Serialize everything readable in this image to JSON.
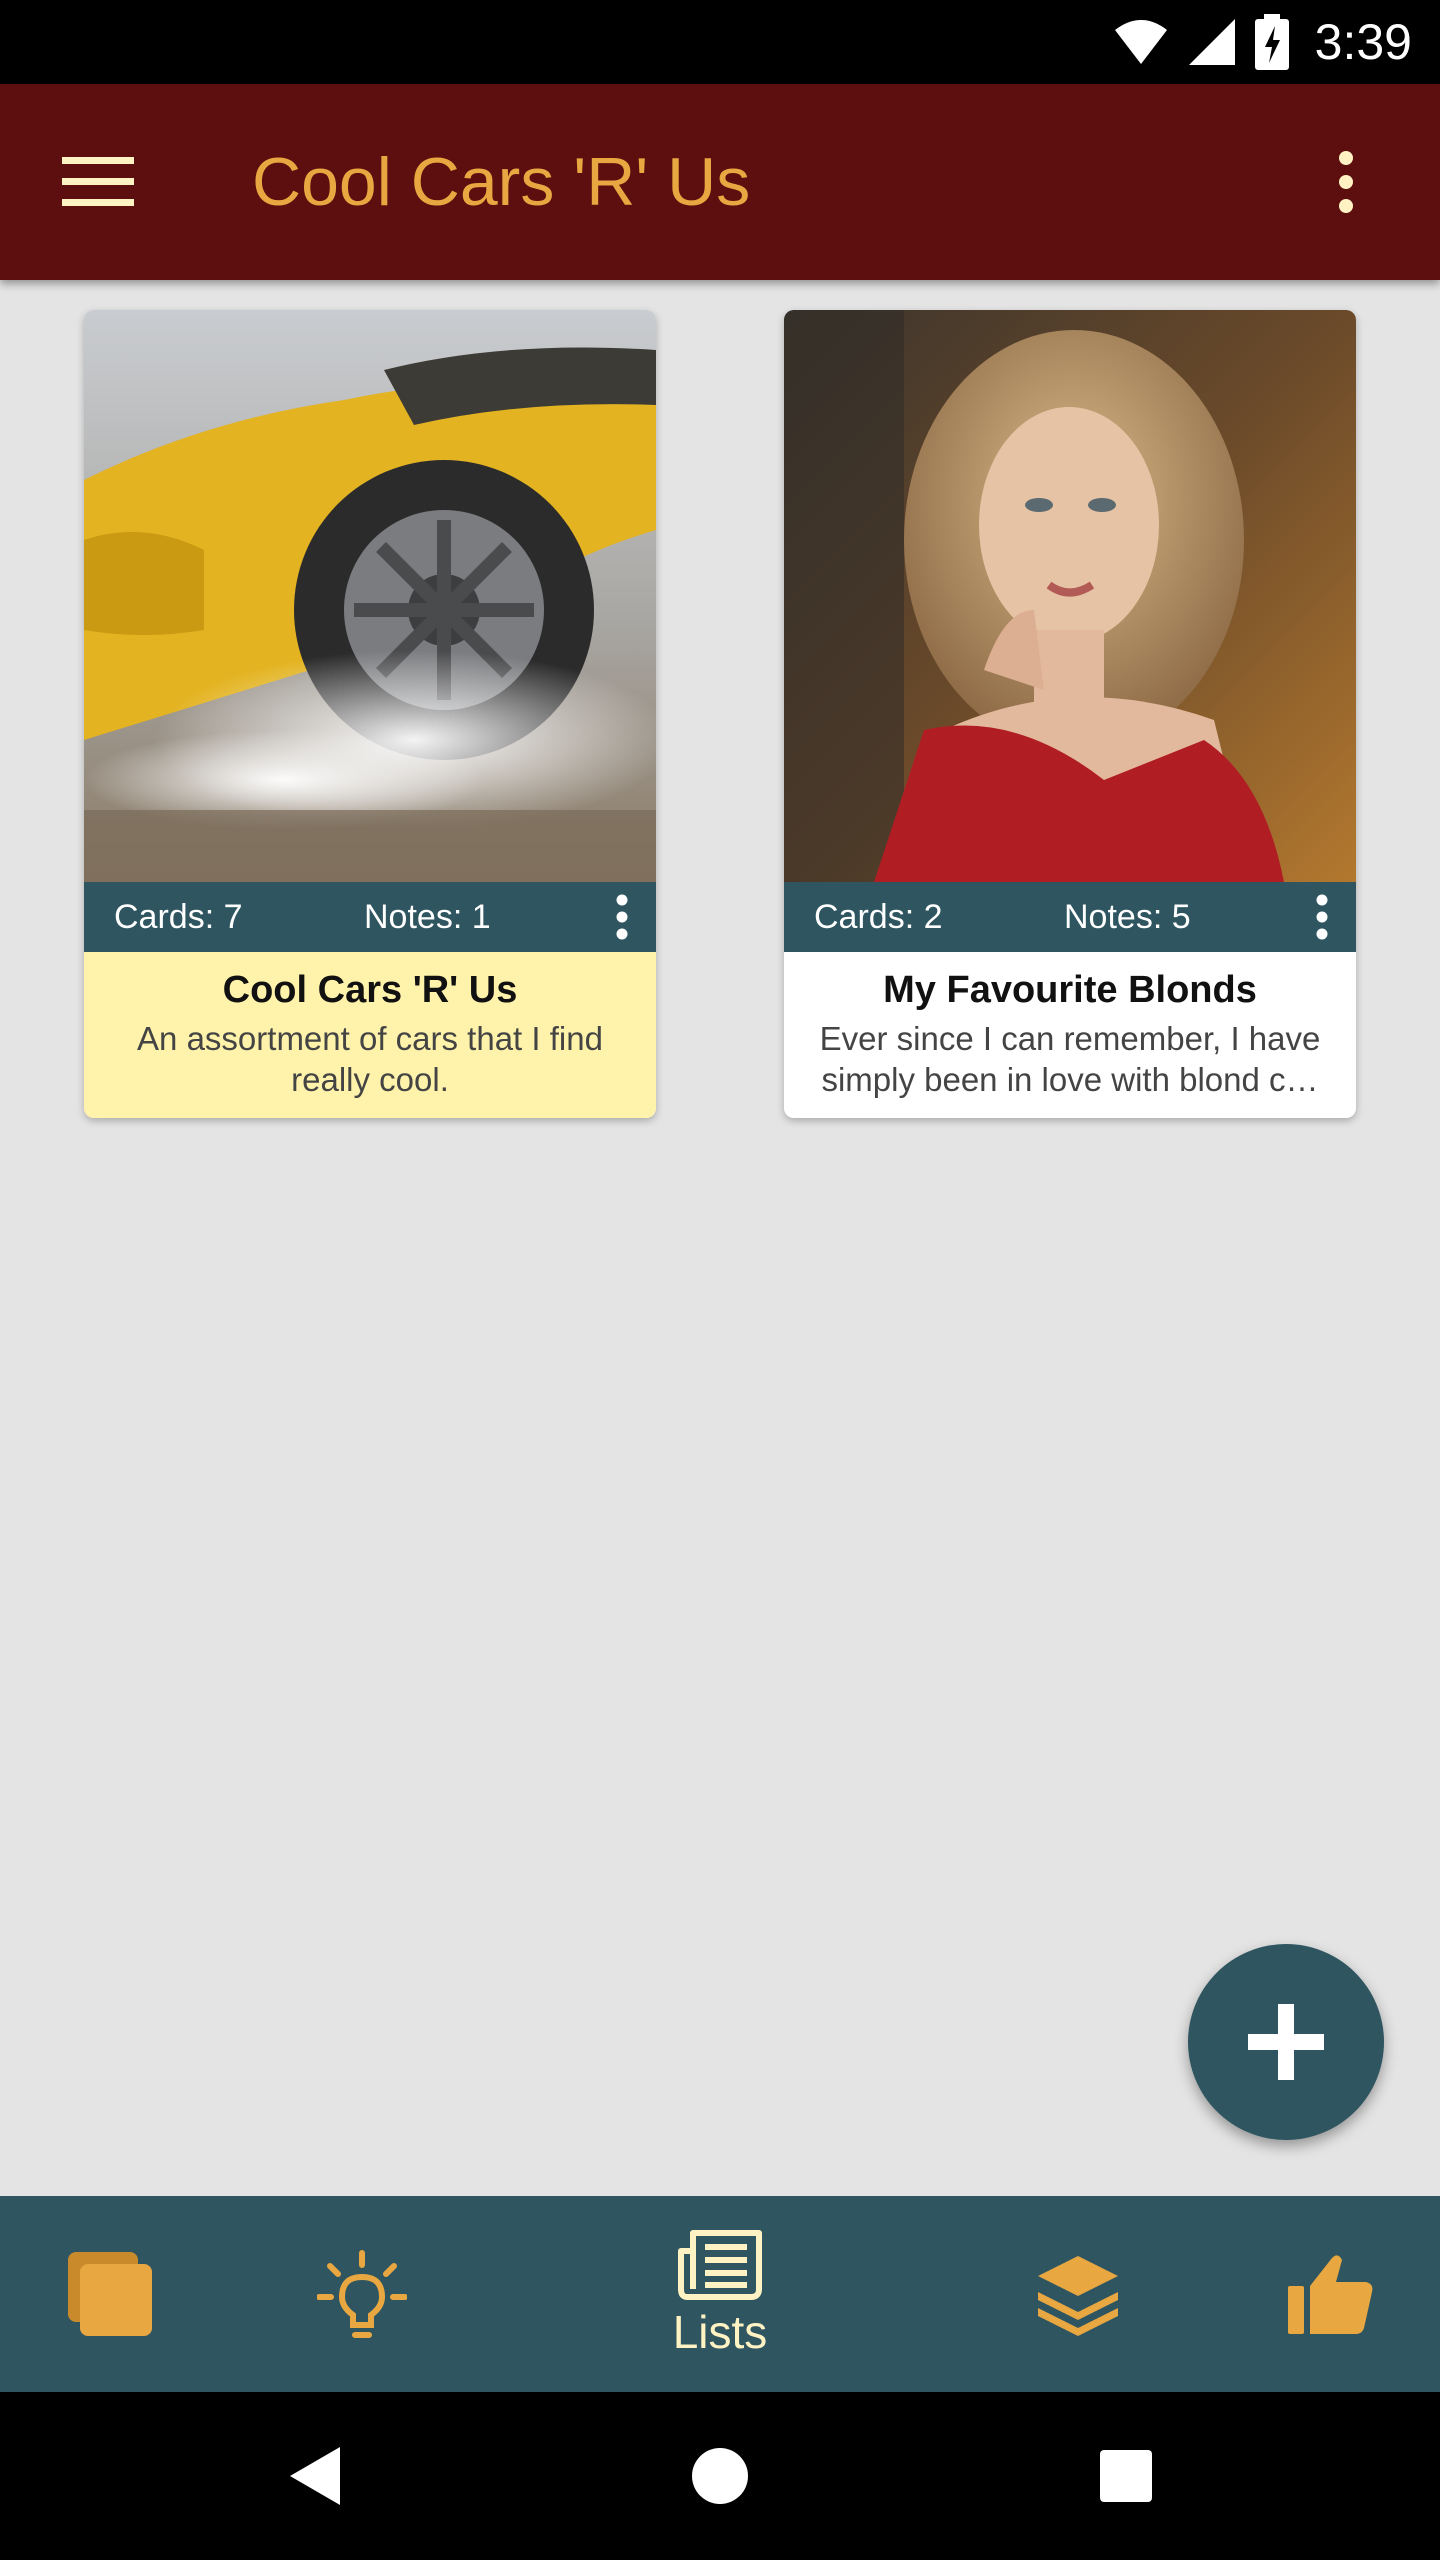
{
  "status_bar": {
    "time": "3:39",
    "icons": [
      "wifi-icon",
      "signal-icon",
      "battery-charging-icon"
    ]
  },
  "app_bar": {
    "title": "Cool Cars 'R' Us",
    "menu_icon": "hamburger-menu-icon",
    "overflow_icon": "more-vert-icon",
    "title_color": "#e9a741",
    "bg_color": "#5d0e0e"
  },
  "lists": [
    {
      "image": "yellow-sports-car-photo",
      "cards_label": "Cards: 7",
      "notes_label": "Notes: 1",
      "title": "Cool Cars 'R' Us",
      "description": "An assortment of cars that I find really cool.",
      "selected": true
    },
    {
      "image": "woman-red-sweater-photo",
      "cards_label": "Cards: 2",
      "notes_label": "Notes: 5",
      "title": "My Favourite Blonds",
      "description": "Ever since I can remember, I have simply been in love with blond c…",
      "selected": false
    }
  ],
  "fab": {
    "icon": "plus-icon"
  },
  "bottom_nav": {
    "items": [
      {
        "icon": "cards-stack-icon"
      },
      {
        "icon": "lightbulb-icon"
      },
      {
        "icon": "newspaper-list-icon",
        "label": "Lists",
        "active": true
      },
      {
        "icon": "layers-icon"
      },
      {
        "icon": "thumbs-up-icon"
      }
    ],
    "accent": "#e9a741",
    "bg_color": "#2e5560"
  },
  "system_nav": {
    "icons": [
      "back-icon",
      "home-icon",
      "recents-icon"
    ]
  }
}
